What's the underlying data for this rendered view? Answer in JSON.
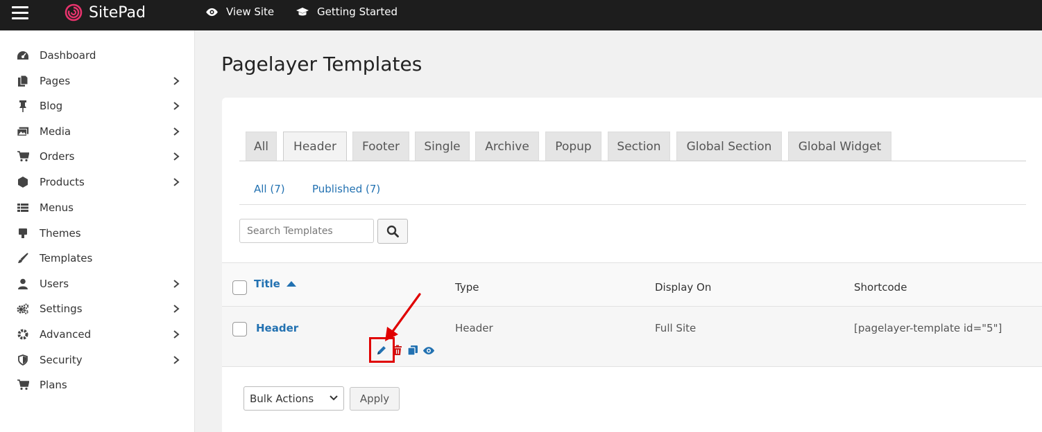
{
  "topbar": {
    "app_name": "SitePad",
    "links": [
      {
        "label": "View Site",
        "icon": "eye-icon"
      },
      {
        "label": "Getting Started",
        "icon": "graduation-cap-icon"
      }
    ]
  },
  "sidebar": {
    "items": [
      {
        "label": "Dashboard",
        "icon": "dashboard-icon",
        "has_submenu": false
      },
      {
        "label": "Pages",
        "icon": "pages-icon",
        "has_submenu": true
      },
      {
        "label": "Blog",
        "icon": "pin-icon",
        "has_submenu": true
      },
      {
        "label": "Media",
        "icon": "media-icon",
        "has_submenu": true
      },
      {
        "label": "Orders",
        "icon": "cart-icon",
        "has_submenu": true
      },
      {
        "label": "Products",
        "icon": "box-icon",
        "has_submenu": true
      },
      {
        "label": "Menus",
        "icon": "list-icon",
        "has_submenu": false
      },
      {
        "label": "Themes",
        "icon": "monitor-icon",
        "has_submenu": false
      },
      {
        "label": "Templates",
        "icon": "brush-icon",
        "has_submenu": false
      },
      {
        "label": "Users",
        "icon": "user-icon",
        "has_submenu": true
      },
      {
        "label": "Settings",
        "icon": "cogs-icon",
        "has_submenu": true
      },
      {
        "label": "Advanced",
        "icon": "gear-icon",
        "has_submenu": true
      },
      {
        "label": "Security",
        "icon": "shield-icon",
        "has_submenu": true
      },
      {
        "label": "Plans",
        "icon": "cart-icon",
        "has_submenu": false
      }
    ]
  },
  "main": {
    "page_title": "Pagelayer Templates",
    "tabs": [
      {
        "label": "All",
        "active": false
      },
      {
        "label": "Header",
        "active": true
      },
      {
        "label": "Footer",
        "active": false
      },
      {
        "label": "Single",
        "active": false
      },
      {
        "label": "Archive",
        "active": false
      },
      {
        "label": "Popup",
        "active": false
      },
      {
        "label": "Section",
        "active": false
      },
      {
        "label": "Global Section",
        "active": false
      },
      {
        "label": "Global Widget",
        "active": false
      }
    ],
    "filters": [
      {
        "label": "All (7)"
      },
      {
        "label": "Published (7)"
      }
    ],
    "search": {
      "placeholder": "Search Templates",
      "value": ""
    },
    "table": {
      "columns": {
        "title": "Title",
        "type": "Type",
        "display_on": "Display On",
        "shortcode": "Shortcode"
      },
      "rows": [
        {
          "title": "Header",
          "type": "Header",
          "display_on": "Full Site",
          "shortcode": "[pagelayer-template id=\"5\"]"
        }
      ]
    },
    "bulk_actions": {
      "selected": "Bulk Actions",
      "apply_label": "Apply"
    }
  },
  "colors": {
    "link": "#2271b1",
    "delete": "#cc1818",
    "highlight": "#e00000",
    "logo": "#e8336d"
  }
}
